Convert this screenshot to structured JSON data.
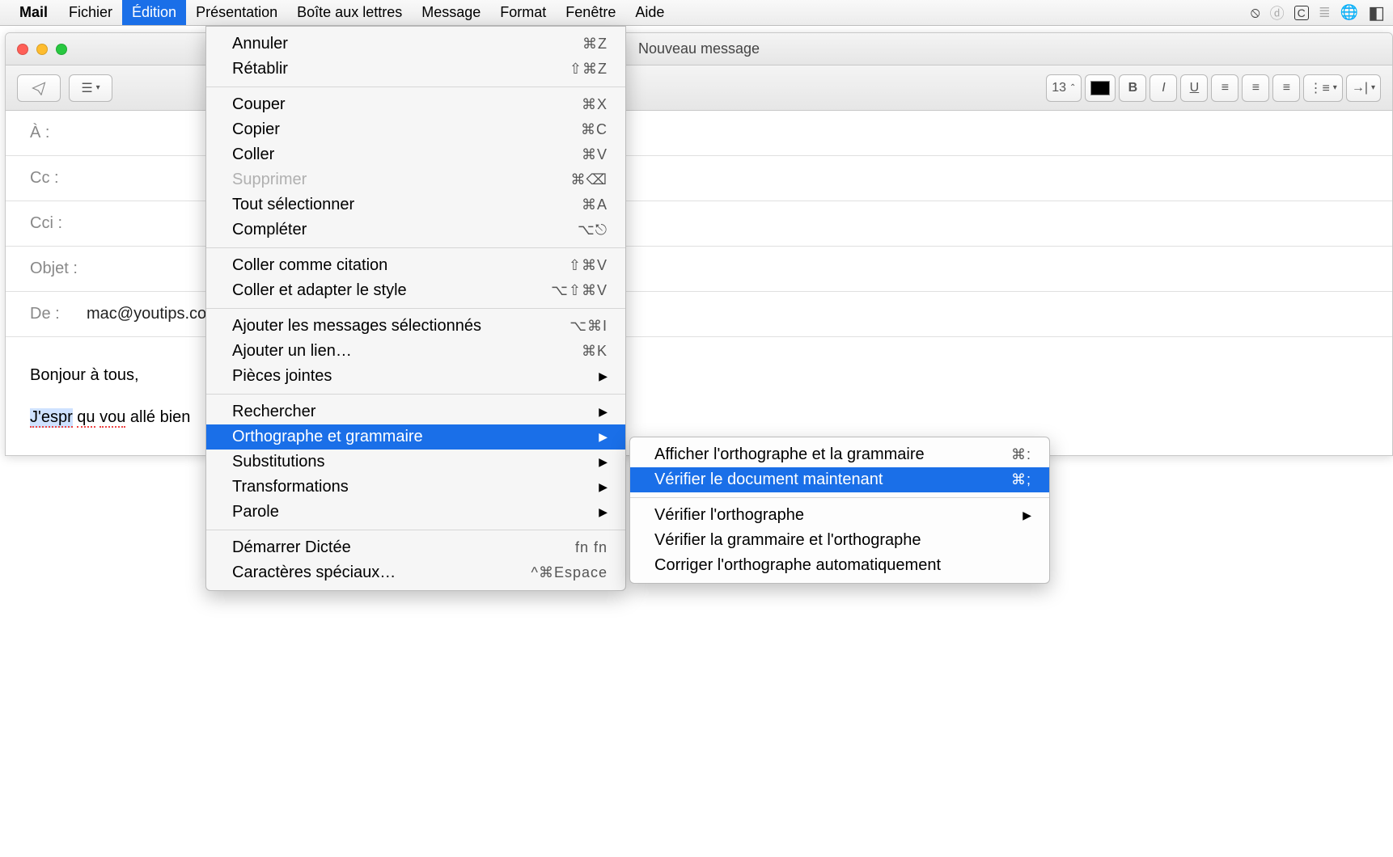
{
  "menubar": {
    "app": "Mail",
    "items": [
      "Fichier",
      "Édition",
      "Présentation",
      "Boîte aux lettres",
      "Message",
      "Format",
      "Fenêtre",
      "Aide"
    ],
    "active_index": 1,
    "tray_icons": [
      "power-icon",
      "d-icon",
      "c-box-icon",
      "lines-icon",
      "globe-icon",
      "bookmark-icon"
    ]
  },
  "window": {
    "title": "Nouveau message",
    "toolbar": {
      "send_icon": "paper-plane-icon",
      "menu_icon": "list-caret-icon",
      "font_name": "Helvetica",
      "font_size": "13",
      "bold": "B",
      "italic": "I",
      "underline": "U"
    },
    "fields": {
      "to_label": "À :",
      "cc_label": "Cc :",
      "bcc_label": "Cci :",
      "subject_label": "Objet :",
      "from_label": "De :",
      "from_value": "mac@youtips.co"
    },
    "compose": {
      "line1": "Bonjour à tous,",
      "line2_w1": "J'espr",
      "line2_w2": "qu",
      "line2_w3": "vou",
      "line2_rest": " allé bien"
    }
  },
  "dropdown": {
    "items": [
      {
        "label": "Annuler",
        "shortcut": "⌘Z"
      },
      {
        "label": "Rétablir",
        "shortcut": "⇧⌘Z"
      },
      {
        "sep": true
      },
      {
        "label": "Couper",
        "shortcut": "⌘X"
      },
      {
        "label": "Copier",
        "shortcut": "⌘C"
      },
      {
        "label": "Coller",
        "shortcut": "⌘V"
      },
      {
        "label": "Supprimer",
        "shortcut": "⌘⌫",
        "disabled": true
      },
      {
        "label": "Tout sélectionner",
        "shortcut": "⌘A"
      },
      {
        "label": "Compléter",
        "shortcut": "⌥⎋"
      },
      {
        "sep": true
      },
      {
        "label": "Coller comme citation",
        "shortcut": "⇧⌘V"
      },
      {
        "label": "Coller et adapter le style",
        "shortcut": "⌥⇧⌘V"
      },
      {
        "sep": true
      },
      {
        "label": "Ajouter les messages sélectionnés",
        "shortcut": "⌥⌘I"
      },
      {
        "label": "Ajouter un lien…",
        "shortcut": "⌘K"
      },
      {
        "label": "Pièces jointes",
        "submenu": true
      },
      {
        "sep": true
      },
      {
        "label": "Rechercher",
        "submenu": true
      },
      {
        "label": "Orthographe et grammaire",
        "submenu": true,
        "highlight": true
      },
      {
        "label": "Substitutions",
        "submenu": true
      },
      {
        "label": "Transformations",
        "submenu": true
      },
      {
        "label": "Parole",
        "submenu": true
      },
      {
        "sep": true
      },
      {
        "label": "Démarrer Dictée",
        "shortcut": "fn fn"
      },
      {
        "label": "Caractères spéciaux…",
        "shortcut": "^⌘Espace"
      }
    ]
  },
  "submenu": {
    "items": [
      {
        "label": "Afficher l'orthographe et la grammaire",
        "shortcut": "⌘:"
      },
      {
        "label": "Vérifier le document maintenant",
        "shortcut": "⌘;",
        "highlight": true
      },
      {
        "sep": true
      },
      {
        "label": "Vérifier l'orthographe",
        "submenu": true
      },
      {
        "label": "Vérifier la grammaire et l'orthographe"
      },
      {
        "label": "Corriger l'orthographe automatiquement"
      }
    ]
  }
}
